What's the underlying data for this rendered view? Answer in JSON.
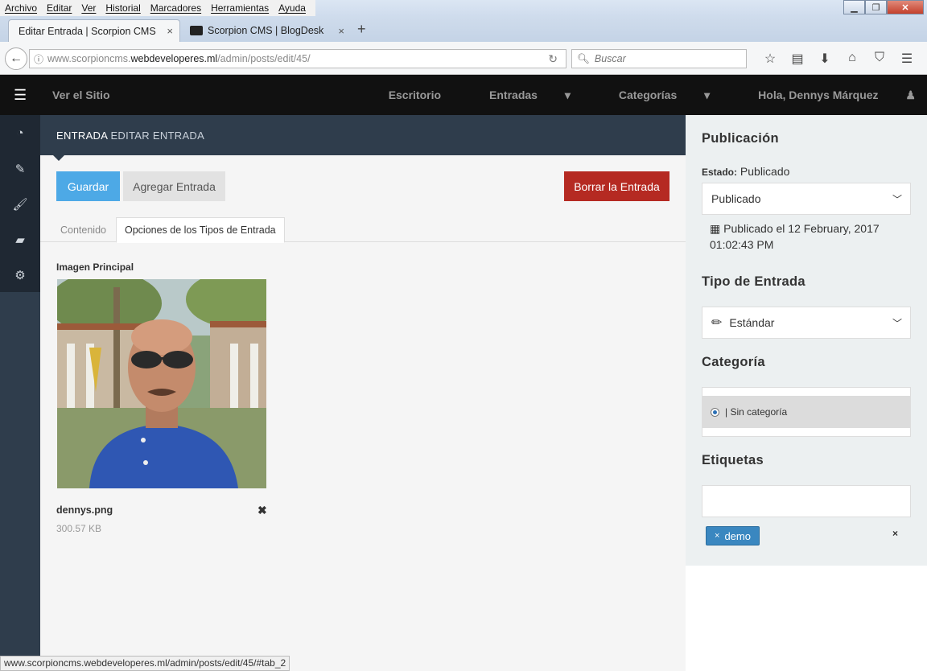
{
  "browser": {
    "menu": [
      "Archivo",
      "Editar",
      "Ver",
      "Historial",
      "Marcadores",
      "Herramientas",
      "Ayuda"
    ],
    "tabs": [
      {
        "title": "Editar Entrada | Scorpion CMS",
        "close_icon": "×"
      },
      {
        "title": "Scorpion CMS | BlogDesk",
        "close_icon": "×"
      }
    ],
    "new_tab_icon": "+",
    "url_domain_prefix": "www.scorpioncms.",
    "url_domain": "webdeveloperes.ml",
    "url_path": "/admin/posts/edit/45/",
    "search_placeholder": "Buscar",
    "status_url": "www.scorpioncms.webdeveloperes.ml/admin/posts/edit/45/#tab_2"
  },
  "cms_header": {
    "site_link": "Ver el Sitio",
    "nav": [
      "Escritorio",
      "Entradas",
      "Categorías",
      "Hola, Dennys Márquez"
    ]
  },
  "page": {
    "breadcrumb_main": "ENTRADA",
    "breadcrumb_sub": "EDITAR ENTRADA",
    "save_label": "Guardar",
    "add_label": "Agregar Entrada",
    "delete_label": "Borrar la Entrada",
    "tabs": [
      "Contenido",
      "Opciones de los Tipos de Entrada"
    ],
    "image_label": "Imagen Principal",
    "file_name": "dennys.png",
    "file_size": "300.57 KB"
  },
  "panel": {
    "publish_title": "Publicación",
    "status_label": "Estado:",
    "status_value": "Publicado",
    "status_select": "Publicado",
    "published_date": "Publicado el 12 February, 2017 01:02:43 PM",
    "type_title": "Tipo de Entrada",
    "type_select": "Estándar",
    "category_title": "Categoría",
    "category_option": "| Sin categoría",
    "tags_title": "Etiquetas",
    "tag": "demo"
  }
}
